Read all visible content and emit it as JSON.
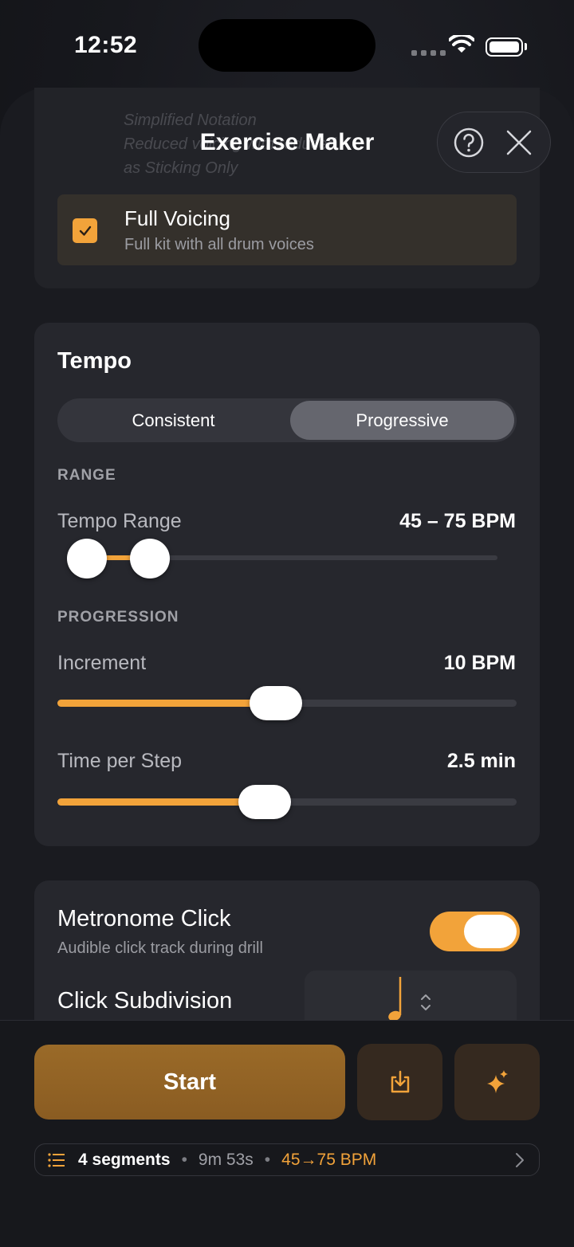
{
  "status_bar": {
    "time": "12:52"
  },
  "header": {
    "title": "Exercise Maker",
    "help_icon": "question-circle-icon",
    "close_icon": "close-icon"
  },
  "voicing": {
    "ghost_lines": [
      "Simplified Notation",
      "Reduced voicing with reduced",
      "as Sticking Only"
    ],
    "option": {
      "title": "Full Voicing",
      "subtitle": "Full kit with all drum voices",
      "checked": true
    }
  },
  "tempo": {
    "heading": "Tempo",
    "modes": [
      "Consistent",
      "Progressive"
    ],
    "selected_mode": "Progressive",
    "range_caption": "RANGE",
    "range": {
      "label": "Tempo Range",
      "value": "45 – 75 BPM",
      "low": 45,
      "high": 75
    },
    "progression_caption": "PROGRESSION",
    "increment": {
      "label": "Increment",
      "value": "10 BPM",
      "level": 0.47
    },
    "time_per_step": {
      "label": "Time per Step",
      "value": "2.5 min",
      "level": 0.44
    }
  },
  "metronome": {
    "title": "Metronome Click",
    "subtitle": "Audible click track during drill",
    "enabled": true,
    "subdivision_label": "Click Subdivision",
    "subdivision_icon": "quarter-note-icon"
  },
  "actions": {
    "start_label": "Start",
    "save_icon": "download-tray-icon",
    "ai_icon": "sparkles-icon"
  },
  "summary": {
    "segments": "4 segments",
    "duration": "9m 53s",
    "tempo_span": "45→75 BPM"
  },
  "colors": {
    "accent": "#f2a33a",
    "background": "#141519",
    "card": "#26272d"
  }
}
